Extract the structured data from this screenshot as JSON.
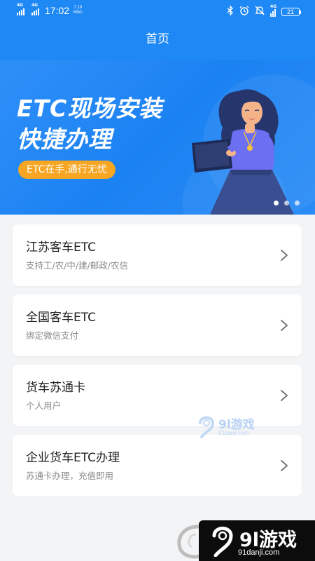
{
  "status_bar": {
    "signal1_tag": "4G",
    "signal2_tag": "4G",
    "time": "17:02",
    "speed_value": "7.10",
    "speed_unit": "KB/s",
    "lte_tag": "4G",
    "battery": "21"
  },
  "header": {
    "title": "首页"
  },
  "banner": {
    "headline_1": "ETC现场安装",
    "headline_2": "快捷办理",
    "pill": "ETC在手,通行无忧",
    "dots_total": 3,
    "dots_active_index": 0
  },
  "cards": [
    {
      "title": "江苏客车ETC",
      "subtitle": "支持工/农/中/建/邮政/农信"
    },
    {
      "title": "全国客车ETC",
      "subtitle": "绑定微信支付"
    },
    {
      "title": "货车苏通卡",
      "subtitle": "个人用户"
    },
    {
      "title": "企业货车ETC办理",
      "subtitle": "苏通卡办理，充值即用"
    }
  ],
  "watermark": {
    "mid_title": "9l游戏",
    "mid_url": "91danji.com",
    "bottom_title": "9l游戏",
    "bottom_url": "91danji.com"
  },
  "colors": {
    "primary": "#1e88f4",
    "accent": "#f6a623",
    "background": "#f3f4f6"
  }
}
